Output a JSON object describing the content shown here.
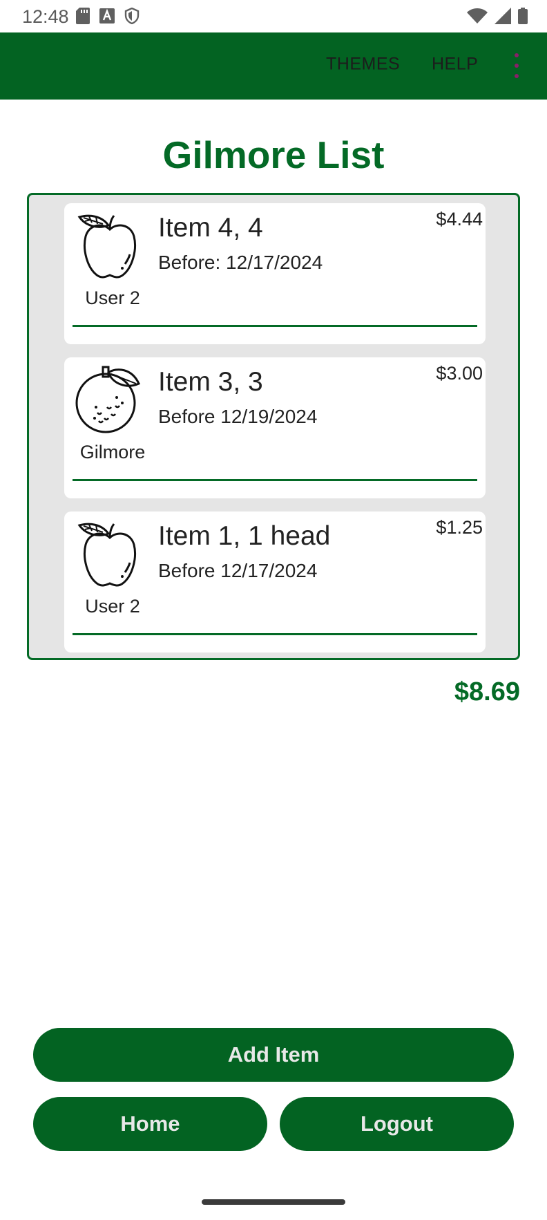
{
  "status_bar": {
    "time": "12:48",
    "left_icons": [
      "sd-card-icon",
      "font-a-icon",
      "shield-icon"
    ],
    "right_icons": [
      "wifi-icon",
      "cell-signal-icon",
      "battery-icon"
    ]
  },
  "app_bar": {
    "actions": [
      "THEMES",
      "HELP"
    ],
    "overflow_icon": "more-vert-icon",
    "background": "#036322"
  },
  "page": {
    "title": "Gilmore List",
    "accent_color": "#046a26"
  },
  "items": [
    {
      "icon": "apple-icon",
      "user": "User 2",
      "name": "Item 4, 4",
      "date": "Before: 12/17/2024",
      "price": "$4.44"
    },
    {
      "icon": "orange-icon",
      "user": "Gilmore",
      "name": "Item 3, 3",
      "date": "Before 12/19/2024",
      "price": "$3.00"
    },
    {
      "icon": "apple-icon",
      "user": "User 2",
      "name": "Item 1, 1 head",
      "date": "Before 12/17/2024",
      "price": "$1.25"
    }
  ],
  "total": "$8.69",
  "buttons": {
    "add_item": "Add Item",
    "home": "Home",
    "logout": "Logout"
  }
}
